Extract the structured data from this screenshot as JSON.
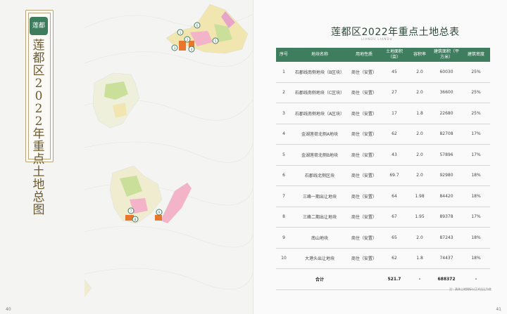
{
  "left_page": {
    "vertical_title": "莲都区2022年重点土地总图",
    "logo_text": "莲都",
    "page_number": "40"
  },
  "right_page": {
    "title": "莲都区2022年重点土地总表",
    "subtitle": "LIANDU LIANDU",
    "page_number": "41",
    "note": "注：具体土地指标以正式出让为准",
    "table": {
      "headers": [
        "序号",
        "地块名称",
        "用地性质",
        "土地面积（亩）",
        "容积率",
        "建筑面积（平方米）",
        "建筑密度"
      ],
      "rows": [
        [
          "1",
          "石郡线南侧地块（B区块）",
          "商住（安置）",
          "45",
          "2.0",
          "60030",
          "25%"
        ],
        [
          "2",
          "石郡线南侧地块（C区块）",
          "商住（安置）",
          "27",
          "2.0",
          "36600",
          "25%"
        ],
        [
          "3",
          "石郡线南侧地块（A区块）",
          "商住（安置）",
          "17",
          "1.8",
          "22680",
          "25%"
        ],
        [
          "4",
          "金湖莲荷北侧A地块",
          "商住（安置）",
          "62",
          "2.0",
          "82708",
          "17%"
        ],
        [
          "5",
          "金湖莲荷北侧B地块",
          "商住（安置）",
          "43",
          "2.0",
          "57896",
          "17%"
        ],
        [
          "6",
          "石郡线北侧区块",
          "商住（安置）",
          "69.7",
          "2.0",
          "92980",
          "18%"
        ],
        [
          "7",
          "三峰一期出让地块",
          "商住（安置）",
          "64",
          "1.98",
          "84420",
          "18%"
        ],
        [
          "8",
          "三峰二期出让地块",
          "商住（安置）",
          "67",
          "1.95",
          "89378",
          "17%"
        ],
        [
          "9",
          "南山地块",
          "商住（安置）",
          "65",
          "2.0",
          "87243",
          "18%"
        ],
        [
          "10",
          "大港头出让地块",
          "商住（安置）",
          "62",
          "1.8",
          "74437",
          "18%"
        ]
      ],
      "total": [
        "",
        "合计",
        "",
        "521.7",
        "-",
        "688372",
        "-"
      ]
    }
  },
  "map_markers": [
    "1",
    "2",
    "3",
    "4",
    "5",
    "6",
    "7",
    "8",
    "9",
    "10"
  ],
  "colors": {
    "accent": "#3f7d5f",
    "frame": "#b8a37a",
    "title": "#2e4a3a"
  }
}
